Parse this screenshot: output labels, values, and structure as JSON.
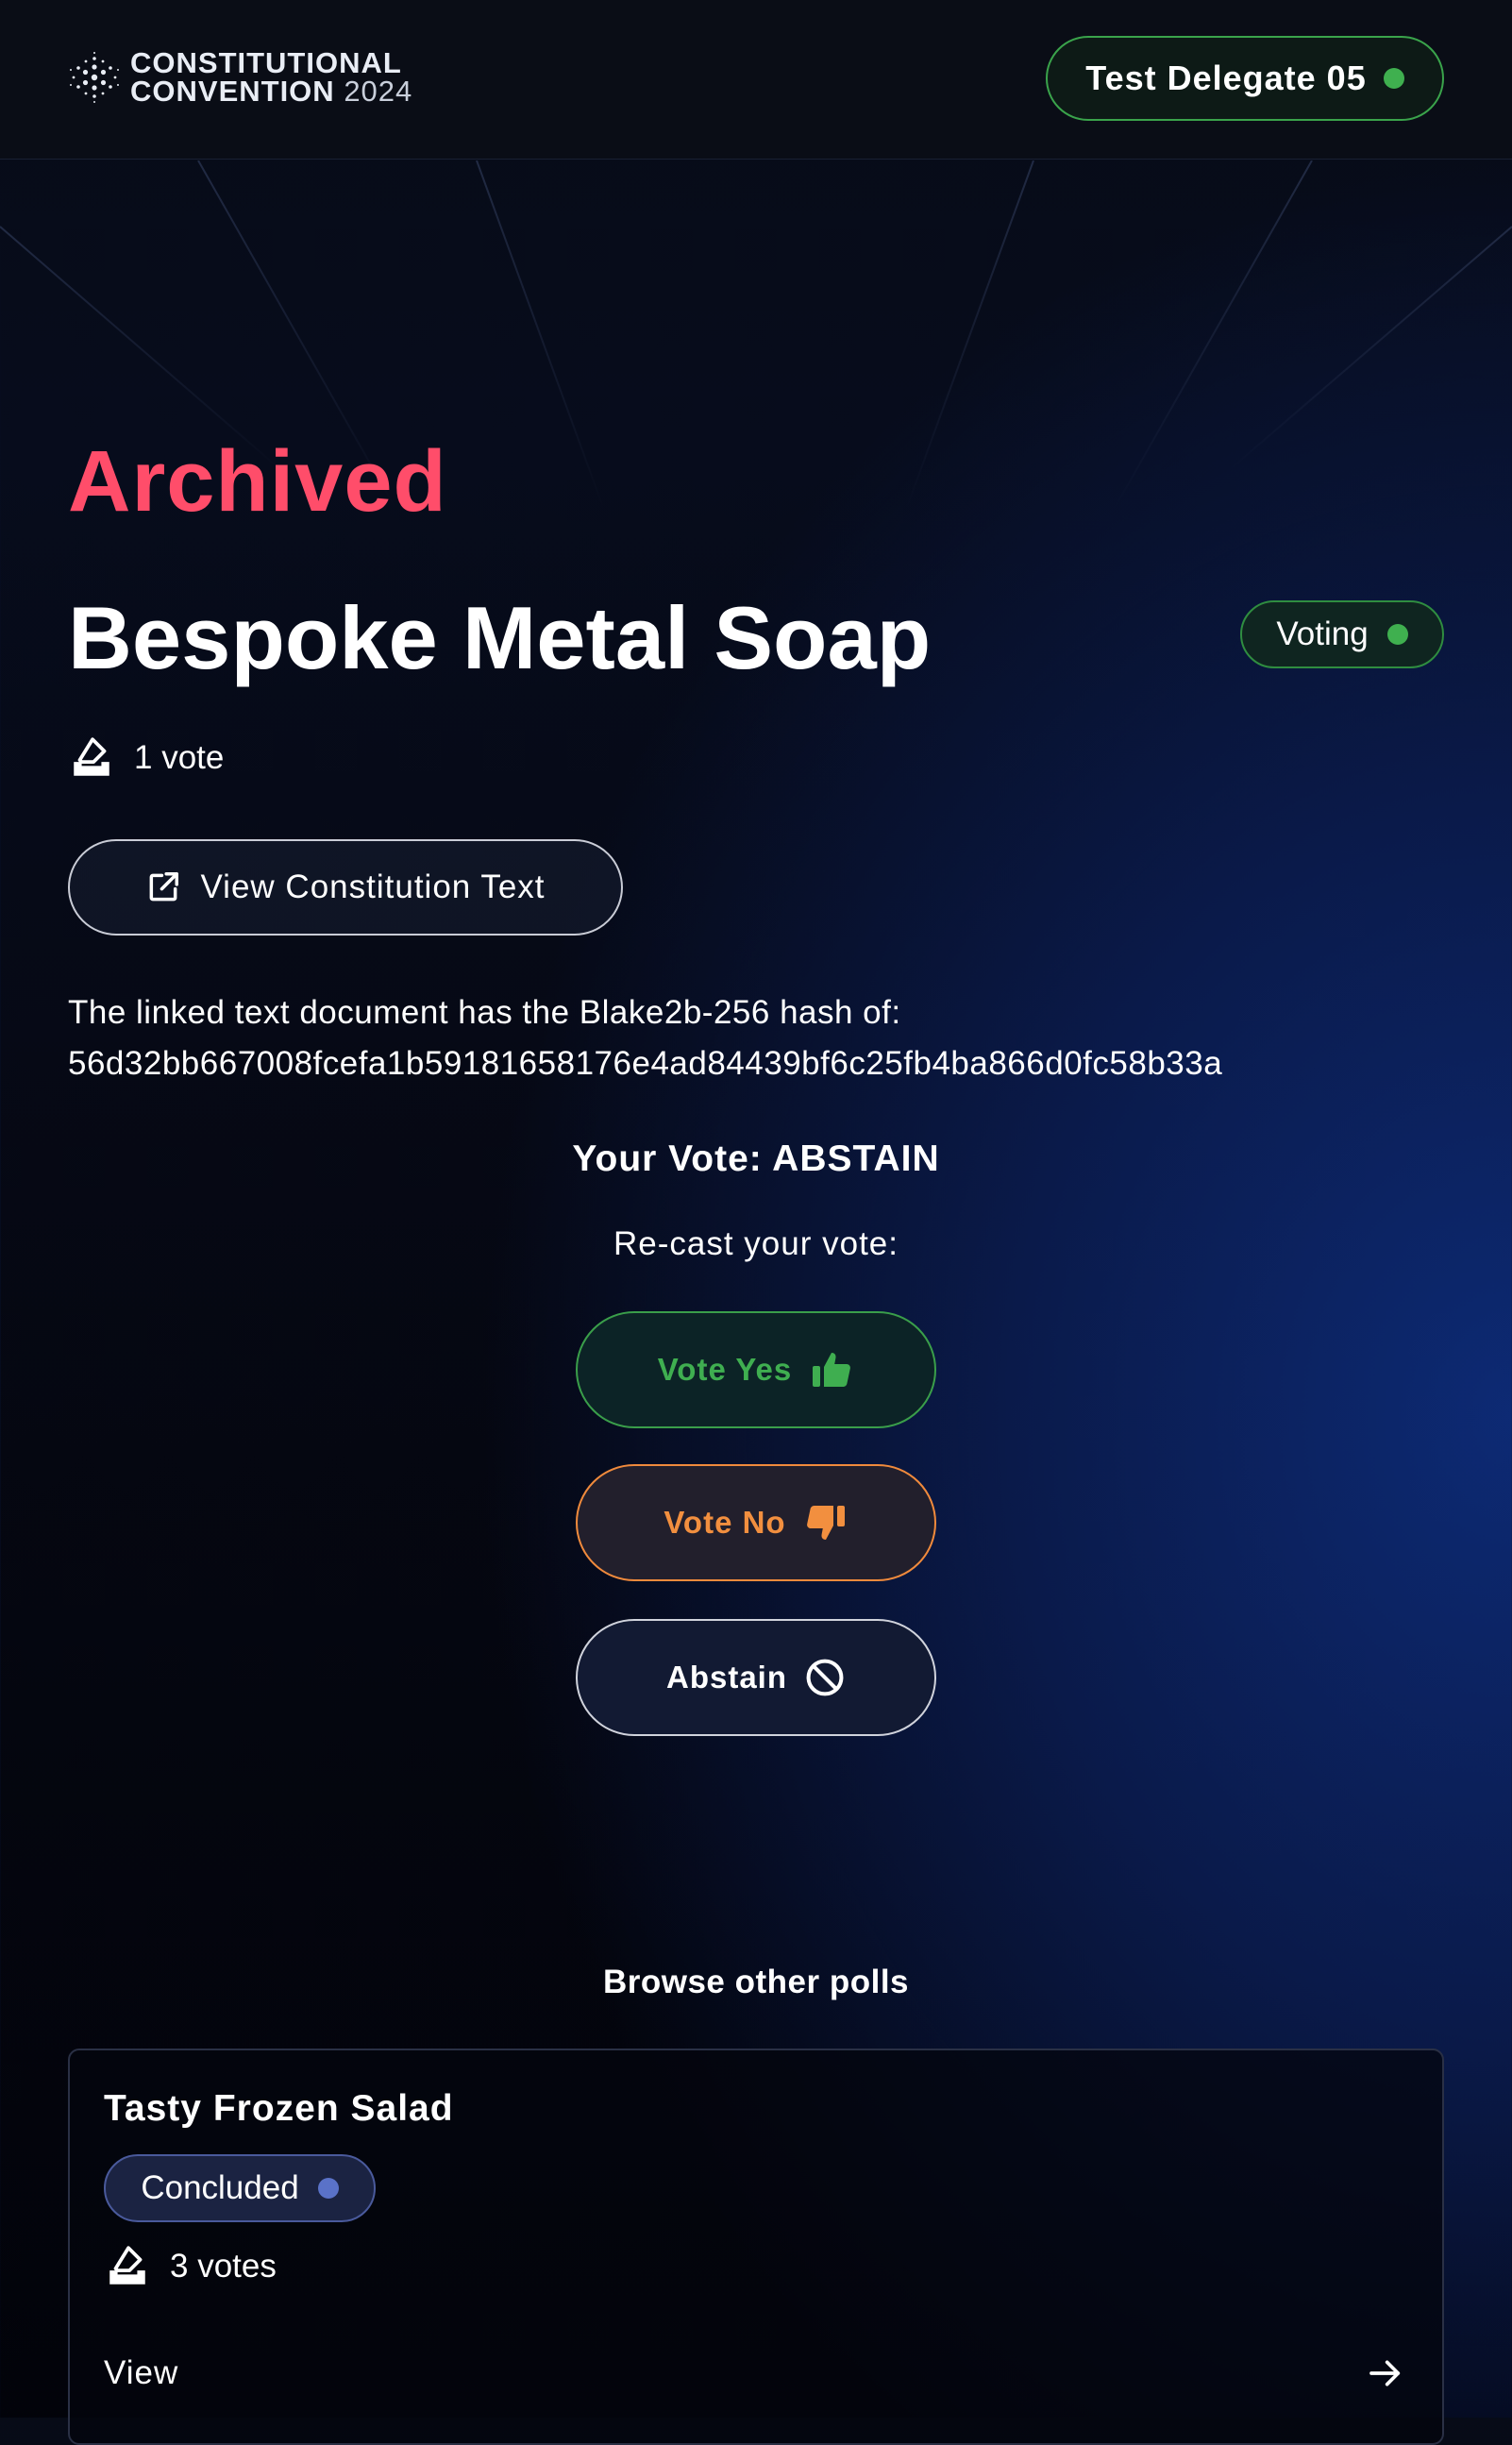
{
  "header": {
    "logo_line1": "CONSTITUTIONAL",
    "logo_line2": "CONVENTION",
    "logo_year": "2024",
    "delegate_name": "Test Delegate 05",
    "delegate_status_color": "#3fb04f"
  },
  "poll": {
    "status": "Archived",
    "title": "Bespoke Metal Soap",
    "badge": "Voting",
    "votes": "1 vote",
    "view_constitution_label": "View Constitution Text",
    "hash_label": "The linked text document has the Blake2b-256 hash of:",
    "hash_value": "56d32bb667008fcefa1b59181658176e4ad84439bf6c25fb4ba866d0fc58b33a"
  },
  "your_vote": {
    "label": "Your Vote:",
    "value": "ABSTAIN",
    "recast_label": "Re-cast your vote:"
  },
  "vote_buttons": {
    "yes": {
      "label": "Vote Yes",
      "icon": "thumbs-up-icon",
      "color": "#3fae50"
    },
    "no": {
      "label": "Vote No",
      "icon": "thumbs-down-icon",
      "color": "#f28f3f"
    },
    "abstain": {
      "label": "Abstain",
      "icon": "prohibited-icon"
    }
  },
  "browse": {
    "heading": "Browse other polls",
    "polls": [
      {
        "title": "Tasty Frozen Salad",
        "badge": "Concluded",
        "votes": "3 votes",
        "view_label": "View"
      }
    ]
  },
  "colors": {
    "archived": "#ff4d6a",
    "voting_green": "#2f8d40",
    "concluded_blue": "#5a72c8"
  }
}
